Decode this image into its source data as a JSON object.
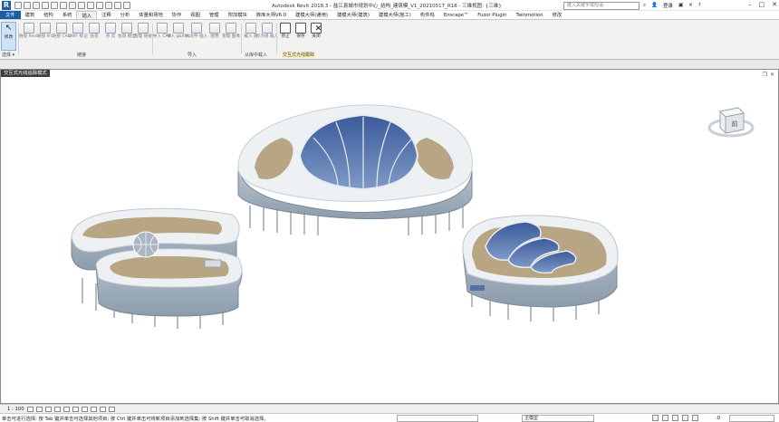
{
  "app": {
    "logo": "R",
    "title": "Autodesk Revit 2018.3 - 盐江县城市规划中心_结构_建筑模_V1_20210517_R18 - 三维视图: {三维}",
    "search_placeholder": "键入关键字或短语",
    "login": "登录"
  },
  "tabs": [
    "文件",
    "建筑",
    "结构",
    "系统",
    "插入",
    "注释",
    "分析",
    "体量和场地",
    "协作",
    "视图",
    "管理",
    "附加模块",
    "族库大师V6.0",
    "建模大师(通用)",
    "建模大师(建筑)",
    "建模大师(施工)",
    "构件坞",
    "Enscape™",
    "Fuzor Plugin",
    "Twinmotion",
    "修改"
  ],
  "ribbon": {
    "buttons": {
      "modify": "修改",
      "link_revit": "链接 Revit",
      "link_ifc": "链接 IFC",
      "link_cad": "链接 CAD",
      "dwf": "DWF 标记",
      "decal": "贴花",
      "point_cloud": "点 云",
      "coord_model": "协调 模型",
      "manage_links": "管理 链接",
      "import_cad": "导入 CAD",
      "import_gbxml": "导入 gbXML",
      "from_file": "从文件 插入",
      "image": "图像",
      "manage_images": "管理 图像",
      "load_family": "载入 族",
      "load_as_group": "作为组 载入",
      "stop": "停止",
      "save": "保存",
      "close": "关闭"
    },
    "panels": {
      "select": "选择 ▾",
      "link": "链接",
      "import": "导入",
      "load_from_library": "从库中载入",
      "interactive_ray": "交互式光线跟踪"
    }
  },
  "viewport": {
    "mode_label": "交互式光线追踪模式",
    "viewcube_face": "前"
  },
  "viewbar": {
    "scale": "1 : 100"
  },
  "status": {
    "text": "单击可进行选择; 按 Tab 键并单击可选择其他项目; 按 Ctrl 键并单击可将新项目添加到选择集; 按 Shift 键并单击可取消选择。",
    "model_field": "主模型",
    "count": ":0"
  }
}
